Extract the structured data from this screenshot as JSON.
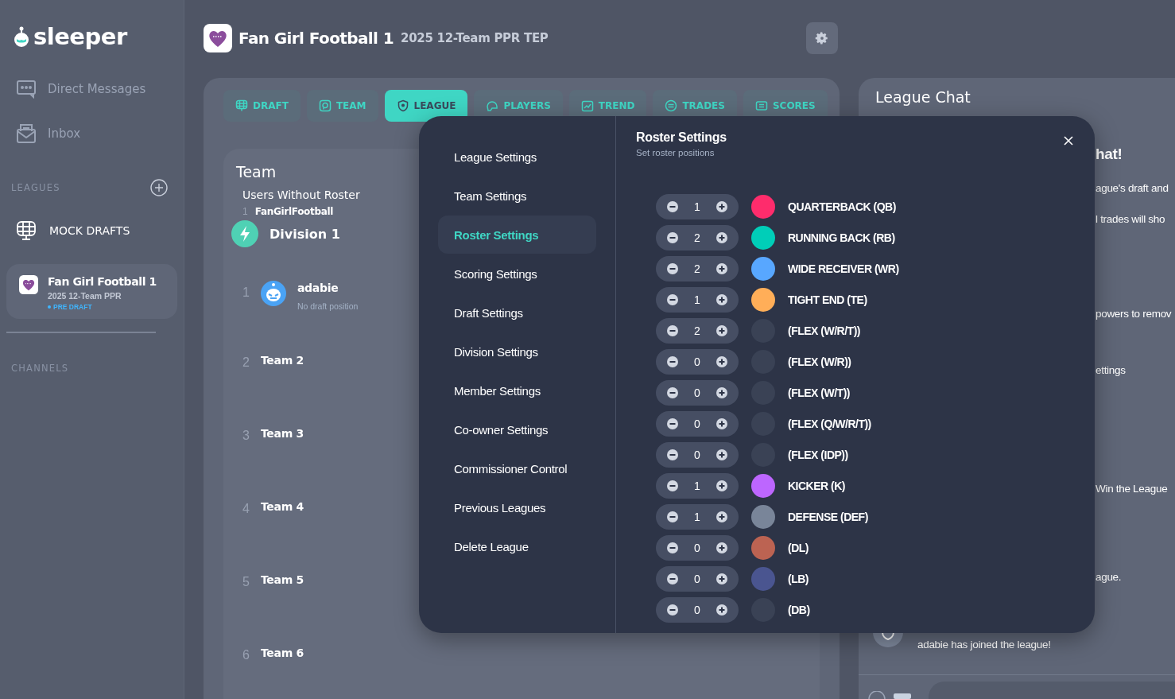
{
  "sidebar": {
    "logo": "sleeper",
    "nav": [
      {
        "label": "Direct Messages"
      },
      {
        "label": "Inbox"
      }
    ],
    "leagues_label": "LEAGUES",
    "mock_drafts": "MOCK DRAFTS",
    "league_card": {
      "name": "Fan Girl Football 1",
      "detail": "2025 12-Team PPR",
      "status": "PRE DRAFT",
      "selected": true
    },
    "channels_label": "CHANNELS"
  },
  "header": {
    "title": "Fan Girl Football 1",
    "subtitle": "2025 12-Team PPR TEP"
  },
  "tabs": [
    {
      "label": "DRAFT",
      "selected": false
    },
    {
      "label": "TEAM",
      "selected": false
    },
    {
      "label": "LEAGUE",
      "selected": true
    },
    {
      "label": "PLAYERS",
      "selected": false
    },
    {
      "label": "TREND",
      "selected": false
    },
    {
      "label": "TRADES",
      "selected": false
    },
    {
      "label": "SCORES",
      "selected": false
    }
  ],
  "team_panel": {
    "title": "Team",
    "users_without_roster": "Users Without Roster",
    "unrostered": [
      {
        "number": "1",
        "name": "FanGirlFootball"
      }
    ],
    "division": "Division 1",
    "teams": [
      {
        "number": "1",
        "name": "adabie",
        "detail": "No draft position",
        "kind": "user"
      },
      {
        "number": "2",
        "name": "Team 2",
        "kind": "empty"
      },
      {
        "number": "3",
        "name": "Team 3",
        "kind": "empty"
      },
      {
        "number": "4",
        "name": "Team 4",
        "kind": "empty"
      },
      {
        "number": "5",
        "name": "Team 5",
        "kind": "empty"
      },
      {
        "number": "6",
        "name": "Team 6",
        "kind": "empty"
      }
    ]
  },
  "chat": {
    "title": "League Chat",
    "fragments": [
      {
        "text": "hat!",
        "kind": "heading"
      },
      {
        "text": "ague's draft and",
        "kind": "line"
      },
      {
        "text": "l trades will sho",
        "kind": "line"
      },
      {
        "text": "powers to remov",
        "kind": "line"
      },
      {
        "text": "ettings",
        "kind": "line"
      },
      {
        "text": "Win the League",
        "kind": "line"
      },
      {
        "text": "ague.",
        "kind": "line"
      }
    ],
    "system_message": "adabie has joined the league!"
  },
  "settings_modal": {
    "menu": [
      {
        "label": "League Settings",
        "selected": false
      },
      {
        "label": "Team Settings",
        "selected": false
      },
      {
        "label": "Roster Settings",
        "selected": true
      },
      {
        "label": "Scoring Settings",
        "selected": false
      },
      {
        "label": "Draft Settings",
        "selected": false
      },
      {
        "label": "Division Settings",
        "selected": false
      },
      {
        "label": "Member Settings",
        "selected": false
      },
      {
        "label": "Co-owner Settings",
        "selected": false
      },
      {
        "label": "Commissioner Control",
        "selected": false
      },
      {
        "label": "Previous Leagues",
        "selected": false
      },
      {
        "label": "Delete League",
        "selected": false
      }
    ],
    "title": "Roster Settings",
    "subtitle": "Set roster positions",
    "positions": [
      {
        "count": "1",
        "label": "QUARTERBACK (QB)",
        "color": "#fe2c6c"
      },
      {
        "count": "2",
        "label": "RUNNING BACK (RB)",
        "color": "#00ceb8"
      },
      {
        "count": "2",
        "label": "WIDE RECEIVER (WR)",
        "color": "#58a7ff"
      },
      {
        "count": "1",
        "label": "TIGHT END (TE)",
        "color": "#ffae58"
      },
      {
        "count": "2",
        "label": "(FLEX (W/R/T))",
        "color": "#3a4255"
      },
      {
        "count": "0",
        "label": "(FLEX (W/R))",
        "color": "#3a4255"
      },
      {
        "count": "0",
        "label": "(FLEX (W/T))",
        "color": "#3a4255"
      },
      {
        "count": "0",
        "label": "(FLEX (Q/W/R/T))",
        "color": "#3a4255"
      },
      {
        "count": "0",
        "label": "(FLEX (IDP))",
        "color": "#3a4255"
      },
      {
        "count": "1",
        "label": "KICKER (K)",
        "color": "#bd66ff"
      },
      {
        "count": "1",
        "label": "DEFENSE (DEF)",
        "color": "#798599"
      },
      {
        "count": "0",
        "label": "(DL)",
        "color": "#bc6352"
      },
      {
        "count": "0",
        "label": "(LB)",
        "color": "#4a5590"
      },
      {
        "count": "0",
        "label": "(DB)",
        "color": "#3a4255"
      }
    ]
  }
}
